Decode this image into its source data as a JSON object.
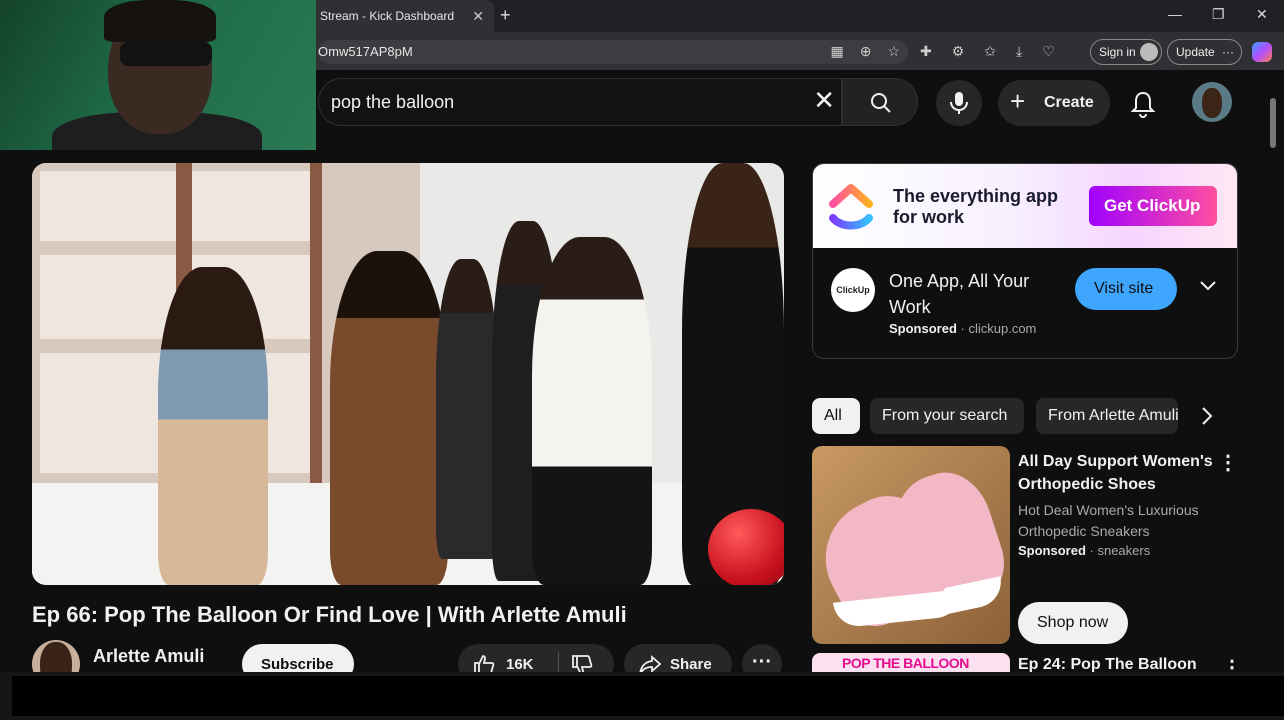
{
  "browser": {
    "tab_title": "Stream - Kick Dashboard",
    "tab_close": "✕",
    "new_tab": "+",
    "url": "Omw517AP8pM",
    "signin_label": "Sign in",
    "update_label": "Update",
    "update_more": "···",
    "window_controls": [
      "—",
      "❐",
      "✕"
    ]
  },
  "youtube": {
    "search_value": "pop the balloon",
    "clear_glyph": "✕",
    "create_label": "Create",
    "create_plus": "+"
  },
  "video": {
    "title": "Ep 66: Pop The Balloon Or Find Love | With Arlette Amuli",
    "channel": "Arlette Amuli",
    "subscribe_label": "Subscribe",
    "like_count": "16K",
    "share_label": "Share",
    "more_glyph": "···"
  },
  "ad": {
    "tagline": "The everything app for work",
    "cta_banner": "Get ClickUp",
    "logo_text": "ClickUp",
    "headline": "One App, All Your Work",
    "sponsored": "Sponsored",
    "domain": "· clickup.com",
    "visit_label": "Visit site"
  },
  "chips": [
    "All",
    "From your search",
    "From Arlette Amuli"
  ],
  "shoe_ad": {
    "title": "All Day Support Women's Orthopedic Shoes",
    "description": "Hot Deal Women's Luxurious Orthopedic Sneakers",
    "sponsored": "Sponsored",
    "category": "· sneakers",
    "cta": "Shop now"
  },
  "next_rec": {
    "thumb_text": "POP THE BALLOON",
    "title": "Ep 24: Pop The Balloon"
  },
  "colors": {
    "accent_blue": "#3ea6ff",
    "clickup_purple": "#a100ff",
    "balloon_red": "#c8101e"
  }
}
